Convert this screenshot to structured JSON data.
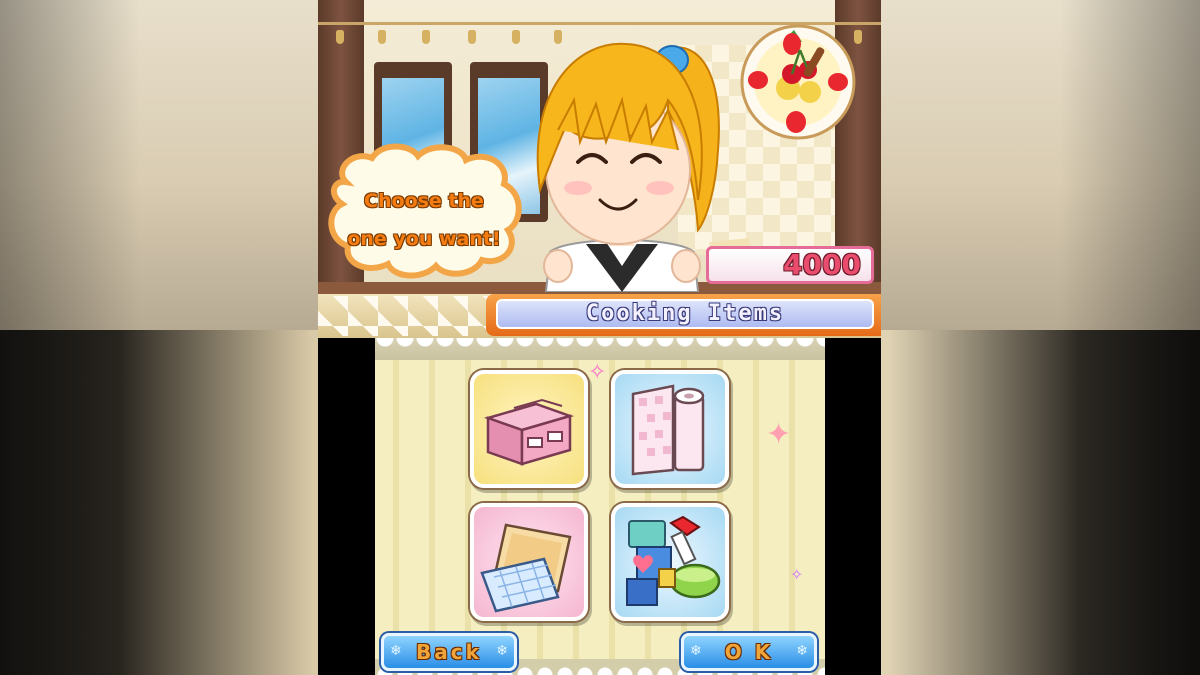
{
  "dialog": {
    "line1": "Choose the",
    "line2": "one you want!"
  },
  "money": {
    "value": "4000"
  },
  "menu": {
    "title": "Cooking Items",
    "items": [
      {
        "icon": "storage-boxes-icon"
      },
      {
        "icon": "paper-roll-icon"
      },
      {
        "icon": "baking-sheets-icon"
      },
      {
        "icon": "decorations-icon"
      }
    ]
  },
  "buttons": {
    "back": "Back",
    "ok": "O K"
  },
  "colors": {
    "title_bar": "#e56a18",
    "button": "#2a8ee6",
    "money": "#ea4c6e",
    "speech_text": "#f57c12"
  }
}
